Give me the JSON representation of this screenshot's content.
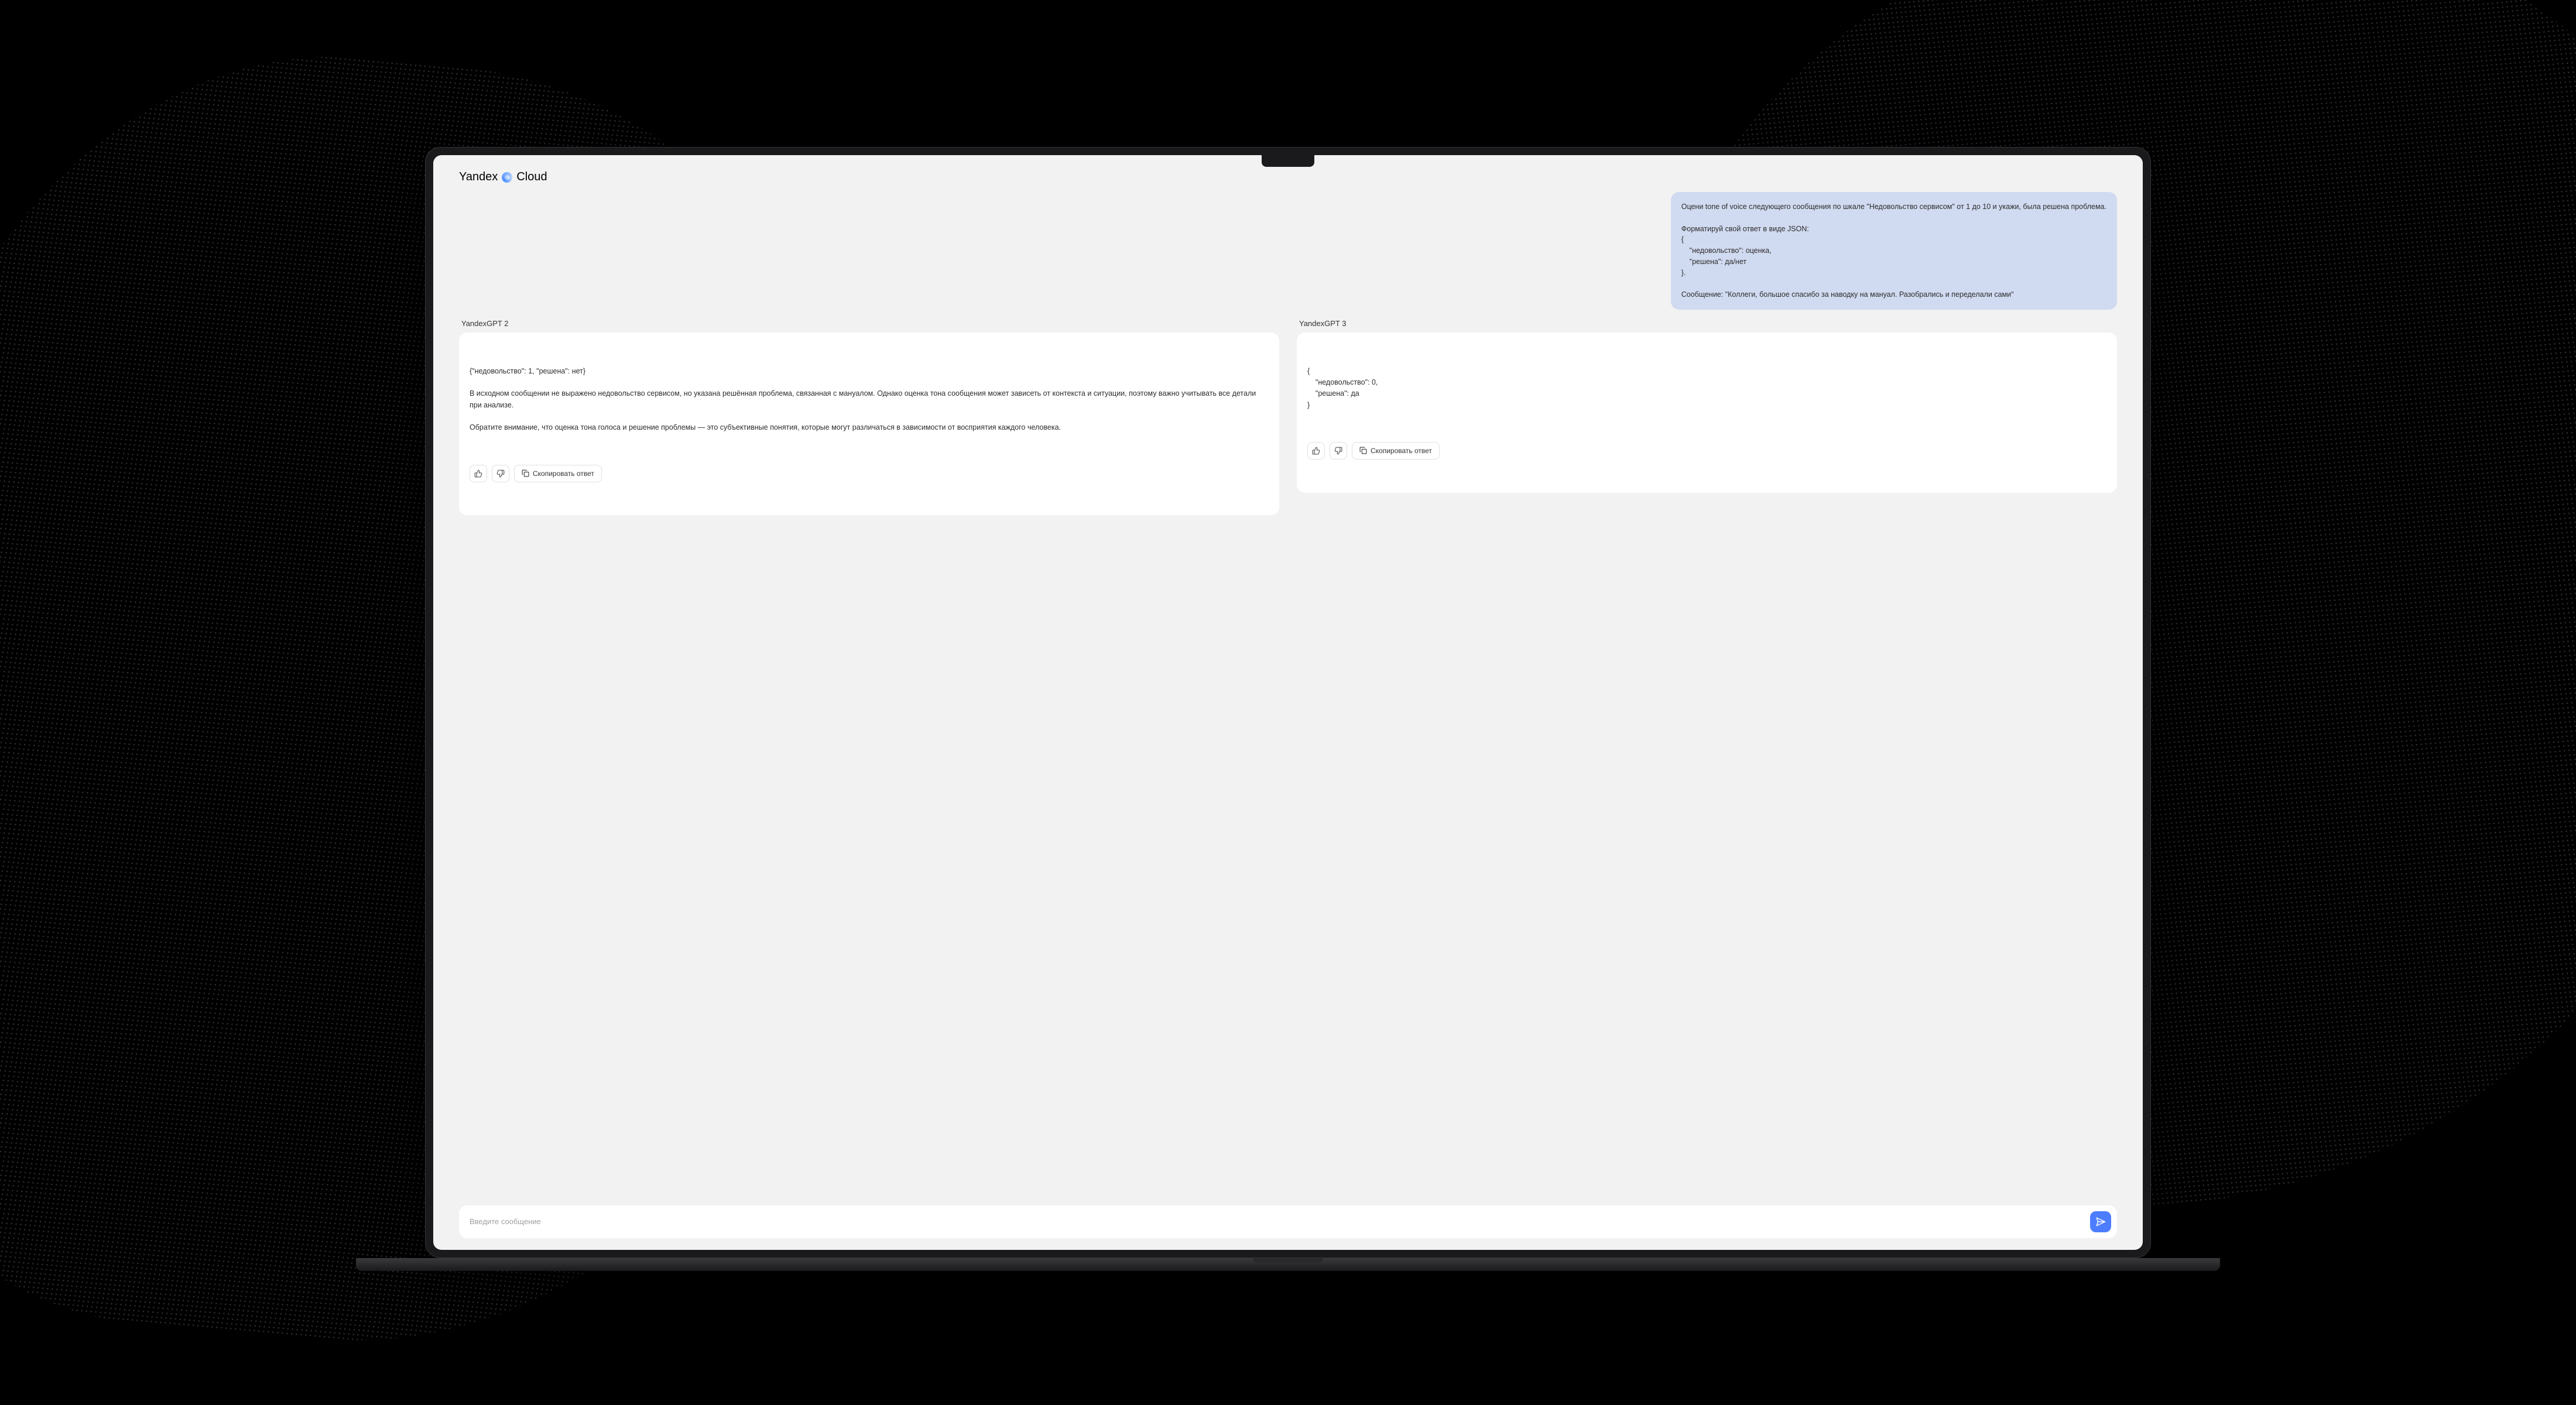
{
  "header": {
    "brand_prefix": "Yandex",
    "brand_suffix": "Cloud"
  },
  "prompt": {
    "text": "Оцени tone of voice следующего сообщения по шкале \"Недовольство сервисом\" от 1 до 10 и укажи, была решена проблема.\n\nФорматируй свой ответ в виде JSON:\n{\n    \"недовольство\": оценка,\n    \"решена\": да/нет\n}.\n\nСообщение: \"Коллеги, большое спасибо за наводку на мануал. Разобрались и переделали сами\""
  },
  "responses": [
    {
      "title": "YandexGPT 2",
      "body": "{\"недовольство\": 1, \"решена\": нет}\n\nВ исходном сообщении не выражено недовольство сервисом, но указана решённая проблема, связанная с мануалом. Однако оценка тона сообщения может зависеть от контекста и ситуации, поэтому важно учитывать все детали при анализе.\n\nОбратите внимание, что оценка тона голоса и решение проблемы — это субъективные понятия, которые могут различаться в зависимости от восприятия каждого человека.",
      "copy_label": "Скопировать ответ"
    },
    {
      "title": "YandexGPT 3",
      "body": "{\n    \"недовольство\": 0,\n    \"решена\": да\n}",
      "copy_label": "Скопировать ответ"
    }
  ],
  "input": {
    "placeholder": "Введите сообщение"
  }
}
